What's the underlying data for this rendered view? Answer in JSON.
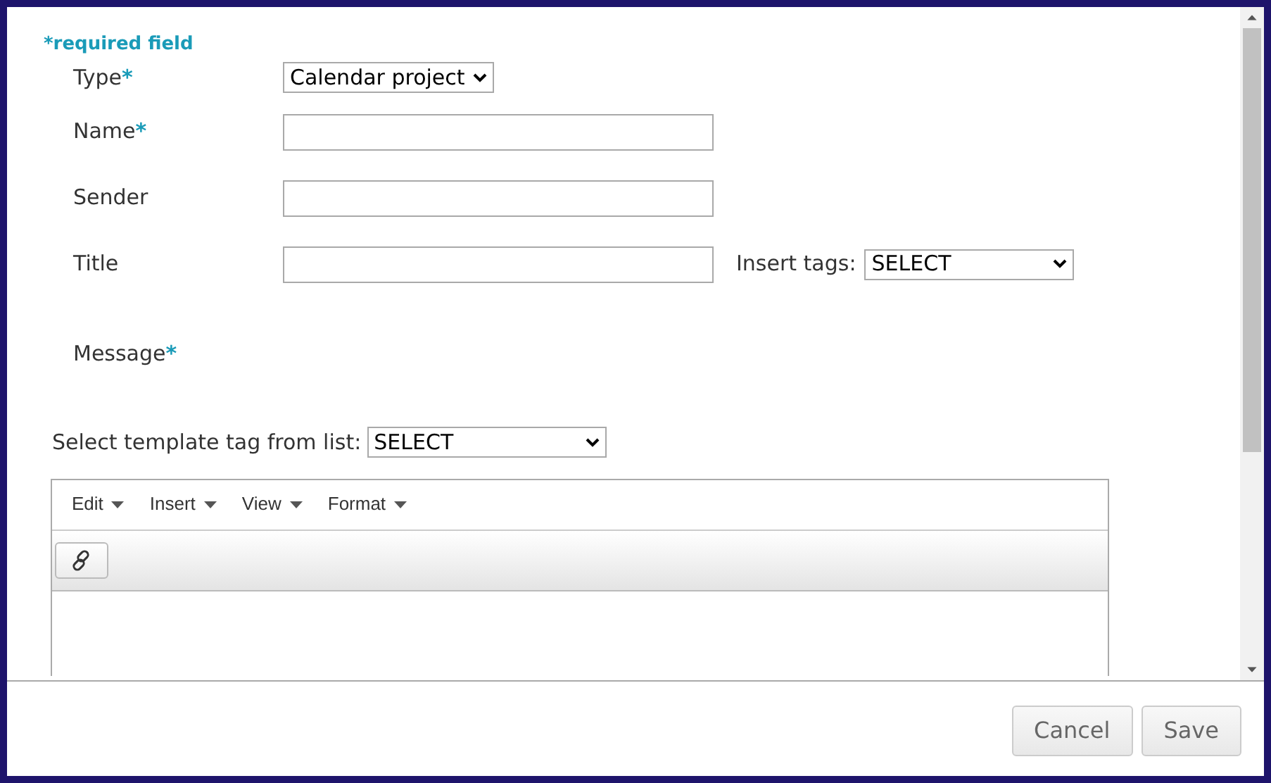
{
  "required_note": "*required field",
  "fields": [
    {
      "kind": "select",
      "label": "Type",
      "required_mark": "*",
      "value": "Calendar project"
    },
    {
      "kind": "text",
      "label": "Name",
      "required_mark": "*"
    },
    {
      "kind": "text",
      "label": "Sender"
    },
    {
      "kind": "text",
      "label": "Title",
      "extra": {
        "label": "Insert tags:",
        "value": "SELECT"
      }
    },
    {
      "kind": "heading",
      "label": "Message",
      "required_mark": "*"
    }
  ],
  "template_tag": {
    "label": "Select template tag from list:",
    "value": "SELECT"
  },
  "editor": {
    "menus": [
      "Edit",
      "Insert",
      "View",
      "Format"
    ]
  },
  "buttons": [
    {
      "label": "Cancel"
    },
    {
      "label": "Save"
    }
  ]
}
